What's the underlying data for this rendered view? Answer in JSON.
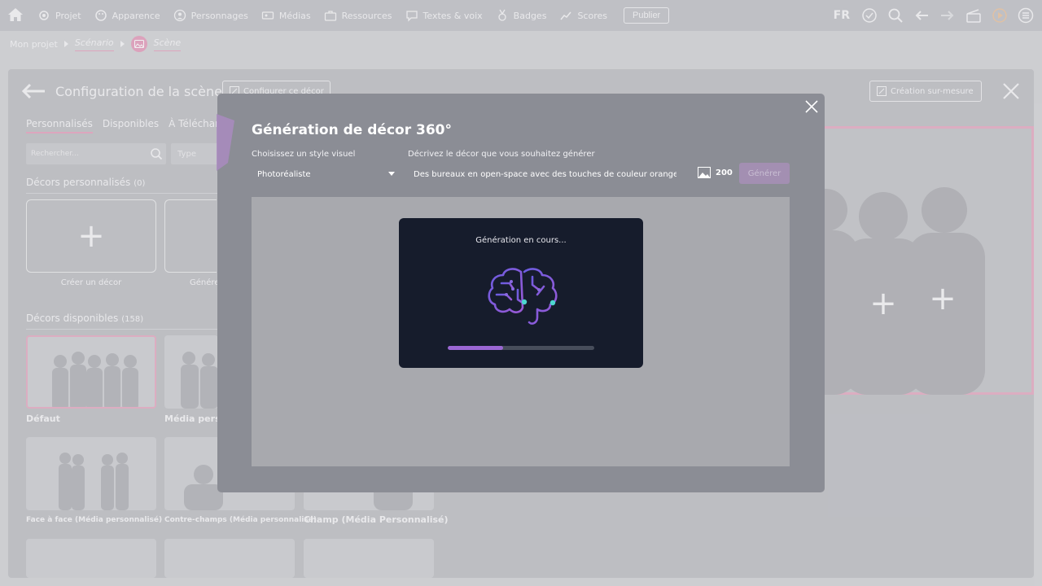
{
  "nav": {
    "items": [
      {
        "label": "Projet",
        "icon": "gear-icon"
      },
      {
        "label": "Apparence",
        "icon": "palette-icon"
      },
      {
        "label": "Personnages",
        "icon": "person-icon"
      },
      {
        "label": "Médias",
        "icon": "media-icon"
      },
      {
        "label": "Ressources",
        "icon": "briefcase-icon"
      },
      {
        "label": "Textes & voix",
        "icon": "speech-icon"
      },
      {
        "label": "Badges",
        "icon": "badge-icon"
      },
      {
        "label": "Scores",
        "icon": "chart-icon"
      }
    ],
    "publish_label": "Publier",
    "language": "FR"
  },
  "breadcrumb": {
    "project": "Mon projet",
    "scenario": "Scénario",
    "scene": "Scène"
  },
  "panel": {
    "title": "Configuration de la scène",
    "configure_label": "Configurer ce décor",
    "custom_label": "Création sur-mesure",
    "tabs": [
      "Personnalisés",
      "Disponibles",
      "À Télécharger"
    ],
    "search_placeholder": "Rechercher...",
    "type_placeholder": "Type",
    "custom_section": "Décors personnalisés",
    "custom_count": "(0)",
    "create_label": "Créer un décor",
    "generate_label": "Générer",
    "available_section": "Décors disponibles",
    "available_count": "(158)",
    "thumbs": [
      {
        "label": "Défaut"
      },
      {
        "label": "Média personnalisé"
      },
      {
        "label": "Face à face (Média personnalisé)"
      },
      {
        "label": "Contre-champs (Média personnalisé)"
      },
      {
        "label": "Champ (Média Personnalisé)"
      }
    ]
  },
  "modal": {
    "title": "Génération de décor 360°",
    "style_label": "Choisissez un style visuel",
    "style_value": "Photoréaliste",
    "prompt_label": "Décrivez le décor que vous souhaitez générer",
    "prompt_value": "Des bureaux en open-space avec des touches de couleur orange",
    "credits": "200",
    "generate_label": "Générer",
    "status": "Génération en cours...",
    "progress": 0.38
  },
  "colors": {
    "accent_pink": "#e7b2c8",
    "progress_purple": "#9b67d4",
    "dialog_dark": "#161c2c"
  }
}
